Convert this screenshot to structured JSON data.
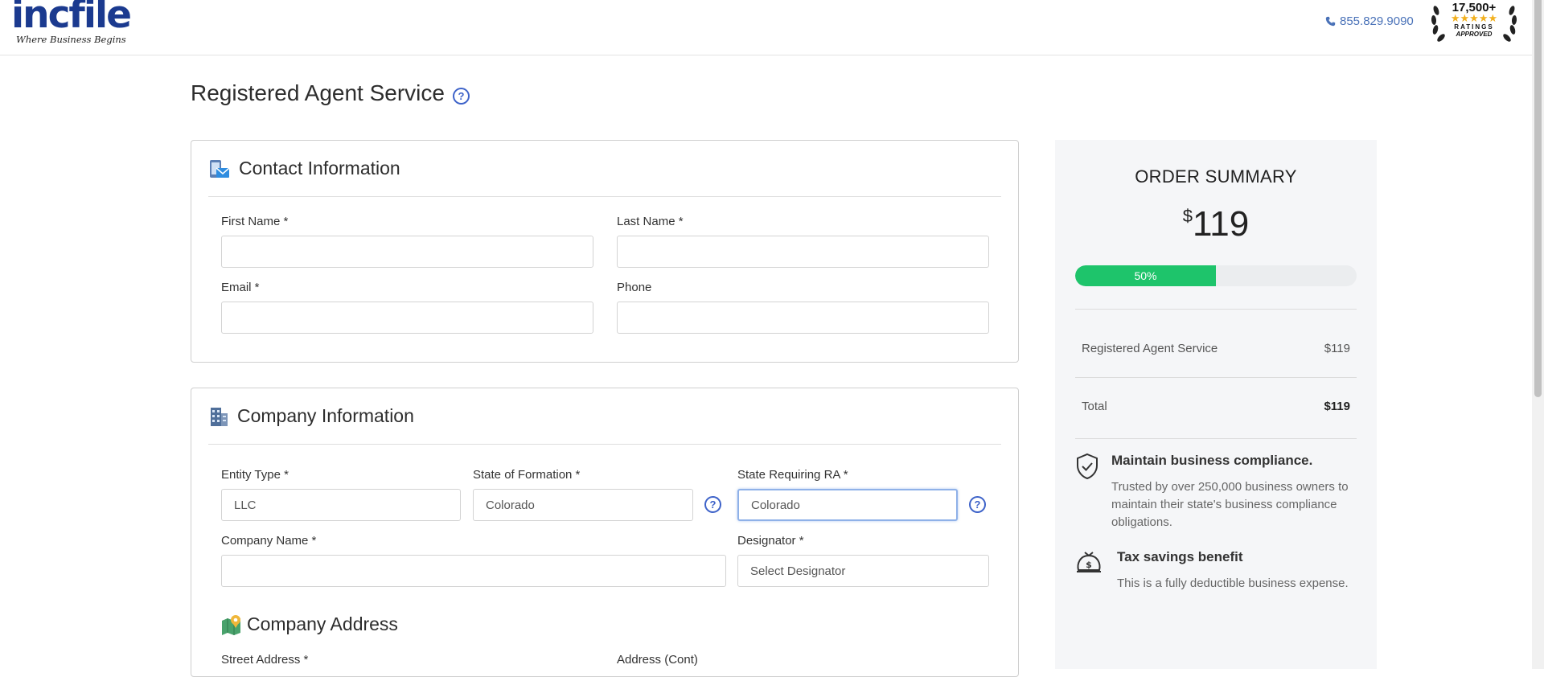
{
  "header": {
    "logo_main": "incfile",
    "logo_tagline": "Where Business Begins",
    "phone": "855.829.9090",
    "badge": {
      "count": "17,500+",
      "stars": "★★★★★",
      "ratings": "RATINGS",
      "approved": "APPROVED"
    }
  },
  "page": {
    "title": "Registered Agent Service"
  },
  "contact": {
    "title": "Contact Information",
    "first_name_label": "First Name *",
    "last_name_label": "Last Name *",
    "email_label": "Email *",
    "phone_label": "Phone",
    "first_name_value": "",
    "last_name_value": "",
    "email_value": "",
    "phone_value": ""
  },
  "company": {
    "title": "Company Information",
    "entity_type_label": "Entity Type *",
    "entity_type_value": "LLC",
    "state_formation_label": "State of Formation *",
    "state_formation_value": "Colorado",
    "state_ra_label": "State Requiring RA *",
    "state_ra_value": "Colorado",
    "company_name_label": "Company Name *",
    "company_name_value": "",
    "designator_label": "Designator *",
    "designator_value": "Select Designator"
  },
  "address": {
    "title": "Company Address",
    "street_label": "Street Address *",
    "address_cont_label": "Address (Cont)"
  },
  "summary": {
    "title": "ORDER SUMMARY",
    "currency": "$",
    "price": "119",
    "progress_label": "50%",
    "progress_value": 0.5,
    "line_item_label": "Registered Agent Service",
    "line_item_price": "$119",
    "total_label": "Total",
    "total_price": "$119",
    "benefits": [
      {
        "title": "Maintain business compliance.",
        "text": "Trusted by over 250,000 business owners to maintain their state's business compliance obligations."
      },
      {
        "title": "Tax savings benefit",
        "text": "This is a fully deductible business expense."
      }
    ]
  },
  "colors": {
    "brand": "#1b3a8f",
    "accent": "#3e63c9",
    "progress": "#1ec46b",
    "phone": "#4a72b8"
  }
}
